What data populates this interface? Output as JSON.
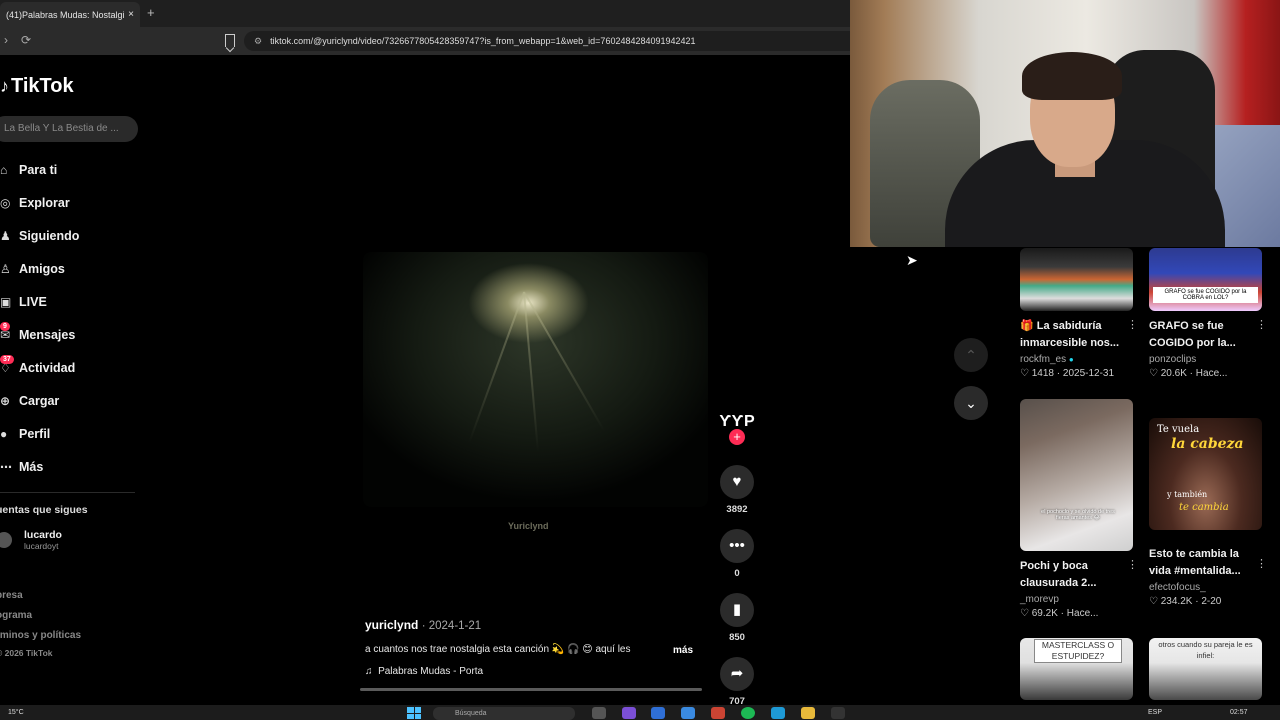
{
  "browser": {
    "tab_title": "(41)Palabras Mudas: Nostalgi",
    "tab_close": "×",
    "new_tab": "+",
    "url": "tiktok.com/@yuriclynd/video/7326677805428359747?is_from_webapp=1&web_id=7602484284091942421"
  },
  "sidebar": {
    "logo": "TikTok",
    "search_placeholder": "La Bella Y La Bestia de ...",
    "nav": [
      {
        "label": "Para ti",
        "icon": "home-icon"
      },
      {
        "label": "Explorar",
        "icon": "compass-icon"
      },
      {
        "label": "Siguiendo",
        "icon": "following-icon"
      },
      {
        "label": "Amigos",
        "icon": "friends-icon"
      },
      {
        "label": "LIVE",
        "icon": "live-icon"
      },
      {
        "label": "Mensajes",
        "icon": "messages-icon",
        "badge": "9"
      },
      {
        "label": "Actividad",
        "icon": "activity-icon",
        "badge": "37"
      },
      {
        "label": "Cargar",
        "icon": "upload-icon"
      },
      {
        "label": "Perfil",
        "icon": "profile-icon"
      },
      {
        "label": "Más",
        "icon": "more-icon"
      }
    ],
    "following_heading": "uentas que sigues",
    "following_user": {
      "name": "lucardo",
      "handle": "lucardoyt"
    },
    "footer": [
      "presa",
      "ograma",
      "rminos y políticas"
    ],
    "copyright": "2026 TikTok"
  },
  "video": {
    "watermark": "Yuriclynd",
    "author": "yuriclynd",
    "date": "2024-1-21",
    "caption": "a cuantos nos trae nostalgia esta canción 💫 🎧 😊 aquí les",
    "more_label": "más",
    "music": "Palabras Mudas - Porta",
    "progress": 0.0
  },
  "actions": {
    "avatar_text": "ƳƳP",
    "likes": "3892",
    "comments": "0",
    "saves": "850",
    "shares": "707"
  },
  "recommended": [
    {
      "title": "🎁 La sabiduría inmarcesible nos...",
      "author": "rockfm_es",
      "verified": true,
      "likes": "1418",
      "time": "2025-12-31",
      "thumb_caption": ""
    },
    {
      "title": "GRAFO se fue COGIDO por la...",
      "author": "ponzoclips",
      "verified": false,
      "likes": "20.6K",
      "time": "Hace...",
      "thumb_caption": "GRAFO se fue COGIDO por la COBRA en LOL?"
    },
    {
      "title": "Pochi y boca clausurada 2...",
      "author": "_morevp",
      "verified": false,
      "likes": "69.2K",
      "time": "Hace...",
      "thumb_caption": "el pochoclo y se olvidó de tres fieras amantes 😂"
    },
    {
      "title": "Esto te cambia la vida #mentalida...",
      "author": "efectofocus_",
      "verified": false,
      "likes": "234.2K",
      "time": "2-20",
      "thumb_caption_1": "Te vuela",
      "thumb_caption_2": "la cabeza",
      "thumb_caption_3": "y también",
      "thumb_caption_4": "te cambia"
    },
    {
      "title": "",
      "author": "",
      "likes": "",
      "time": "",
      "thumb_caption": "MASTERCLASS O ESTUPIDEZ?"
    },
    {
      "title": "",
      "author": "",
      "likes": "",
      "time": "",
      "thumb_caption": "otros cuando su pareja le es infiel:"
    }
  ],
  "taskbar": {
    "weather": "15°C",
    "search": "Búsqueda",
    "lang": "ESP",
    "time": "02:57"
  }
}
